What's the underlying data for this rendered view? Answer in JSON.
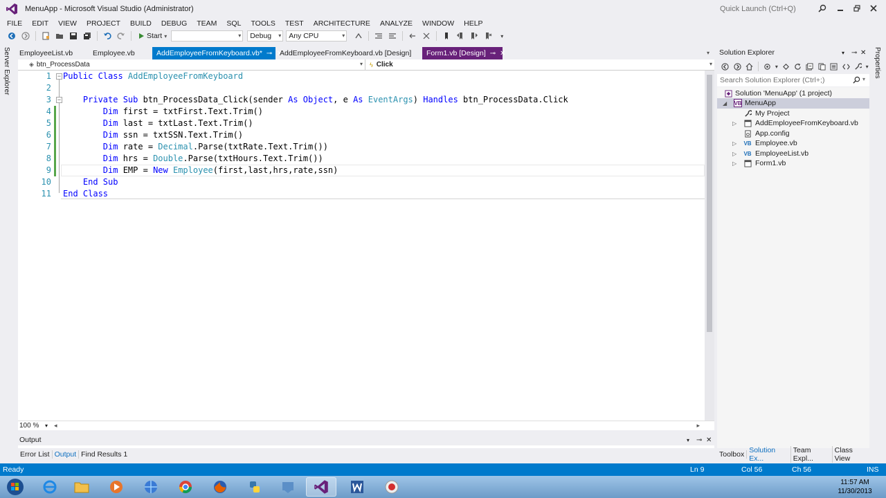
{
  "window": {
    "title": "MenuApp - Microsoft Visual Studio (Administrator)",
    "quick_launch_placeholder": "Quick Launch (Ctrl+Q)"
  },
  "menu": [
    "FILE",
    "EDIT",
    "VIEW",
    "PROJECT",
    "BUILD",
    "DEBUG",
    "TEAM",
    "SQL",
    "TOOLS",
    "TEST",
    "ARCHITECTURE",
    "ANALYZE",
    "WINDOW",
    "HELP"
  ],
  "toolbar": {
    "start_label": "Start",
    "config": "Debug",
    "platform": "Any CPU"
  },
  "left_strip": {
    "label": "Server Explorer"
  },
  "right_strip": {
    "label": "Properties"
  },
  "doc_tabs": [
    {
      "label": "EmployeeList.vb"
    },
    {
      "label": "Employee.vb"
    },
    {
      "label": "AddEmployeeFromKeyboard.vb*"
    },
    {
      "label": "AddEmployeeFromKeyboard.vb [Design]"
    },
    {
      "label": "Form1.vb [Design]"
    }
  ],
  "navbar": {
    "object": "btn_ProcessData",
    "event": "Click"
  },
  "code": {
    "line_numbers": [
      "1",
      "2",
      "3",
      "4",
      "5",
      "6",
      "7",
      "8",
      "9",
      "10",
      "11"
    ],
    "lines": [
      [
        {
          "t": "Public Class ",
          "k": "kw"
        },
        {
          "t": "AddEmployeeFromKeyboard",
          "k": "ty"
        }
      ],
      [],
      [
        {
          "t": "    "
        },
        {
          "t": "Private Sub ",
          "k": "kw"
        },
        {
          "t": "btn_ProcessData_Click(sender "
        },
        {
          "t": "As Object",
          "k": "kw"
        },
        {
          "t": ", e "
        },
        {
          "t": "As ",
          "k": "kw"
        },
        {
          "t": "EventArgs",
          "k": "ty"
        },
        {
          "t": ") "
        },
        {
          "t": "Handles ",
          "k": "kw"
        },
        {
          "t": "btn_ProcessData.Click"
        }
      ],
      [
        {
          "t": "        "
        },
        {
          "t": "Dim ",
          "k": "kw"
        },
        {
          "t": "first = txtFirst.Text.Trim()"
        }
      ],
      [
        {
          "t": "        "
        },
        {
          "t": "Dim ",
          "k": "kw"
        },
        {
          "t": "last = txtLast.Text.Trim()"
        }
      ],
      [
        {
          "t": "        "
        },
        {
          "t": "Dim ",
          "k": "kw"
        },
        {
          "t": "ssn = txtSSN.Text.Trim()"
        }
      ],
      [
        {
          "t": "        "
        },
        {
          "t": "Dim ",
          "k": "kw"
        },
        {
          "t": "rate = "
        },
        {
          "t": "Decimal",
          "k": "ty"
        },
        {
          "t": ".Parse(txtRate.Text.Trim())"
        }
      ],
      [
        {
          "t": "        "
        },
        {
          "t": "Dim ",
          "k": "kw"
        },
        {
          "t": "hrs = "
        },
        {
          "t": "Double",
          "k": "ty"
        },
        {
          "t": ".Parse(txtHours.Text.Trim())"
        }
      ],
      [
        {
          "t": "        "
        },
        {
          "t": "Dim ",
          "k": "kw"
        },
        {
          "t": "EMP = "
        },
        {
          "t": "New ",
          "k": "kw"
        },
        {
          "t": "Employee",
          "k": "ty"
        },
        {
          "t": "(first,last,hrs,rate,ssn)"
        }
      ],
      [
        {
          "t": "    "
        },
        {
          "t": "End Sub",
          "k": "kw"
        }
      ],
      [
        {
          "t": "End Class",
          "k": "kw"
        }
      ]
    ]
  },
  "zoom": "100 %",
  "output_panel": {
    "title": "Output",
    "tabs": [
      "Error List",
      "Output",
      "Find Results 1"
    ],
    "active_tab": "Output"
  },
  "solution_explorer": {
    "title": "Solution Explorer",
    "search_placeholder": "Search Solution Explorer (Ctrl+;)",
    "items": [
      {
        "label": "Solution 'MenuApp' (1 project)",
        "icon": "solution-icon"
      },
      {
        "label": "MenuApp",
        "icon": "vb-project-icon"
      },
      {
        "label": "My Project",
        "icon": "wrench-icon"
      },
      {
        "label": "AddEmployeeFromKeyboard.vb",
        "icon": "form-icon"
      },
      {
        "label": "App.config",
        "icon": "config-icon"
      },
      {
        "label": "Employee.vb",
        "icon": "vb-file-icon"
      },
      {
        "label": "EmployeeList.vb",
        "icon": "vb-file-icon"
      },
      {
        "label": "Form1.vb",
        "icon": "form-icon"
      }
    ],
    "bottom_tabs": [
      "Toolbox",
      "Solution Ex...",
      "Team Expl...",
      "Class View"
    ],
    "active_tab": "Solution Ex..."
  },
  "status": {
    "text": "Ready",
    "line": "Ln 9",
    "col": "Col 56",
    "ch": "Ch 56",
    "mode": "INS"
  },
  "clock": {
    "time": "11:57 AM",
    "date": "11/30/2013"
  },
  "colors": {
    "accent": "#007acc",
    "keyword": "#0000ff",
    "type": "#2b91af",
    "preview_tab": "#68217a"
  }
}
